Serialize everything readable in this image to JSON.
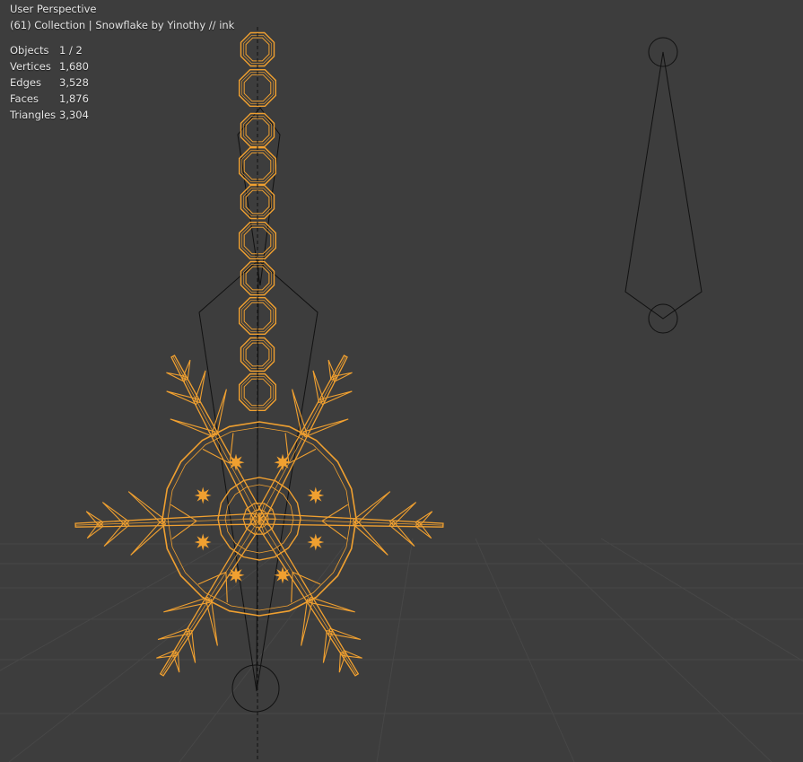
{
  "viewport": {
    "view_name": "User Perspective",
    "collection_line": "(61) Collection | Snowflake by Yinothy // ink"
  },
  "stats": [
    {
      "label": "Objects",
      "value": "1 / 2"
    },
    {
      "label": "Vertices",
      "value": "1,680"
    },
    {
      "label": "Edges",
      "value": "3,528"
    },
    {
      "label": "Faces",
      "value": "1,876"
    },
    {
      "label": "Triangles",
      "value": "3,304"
    }
  ],
  "colors": {
    "background": "#3d3d3d",
    "grid": "#474747",
    "selection": "#f0a030",
    "wire": "#111111",
    "text": "#e6e6e6"
  }
}
